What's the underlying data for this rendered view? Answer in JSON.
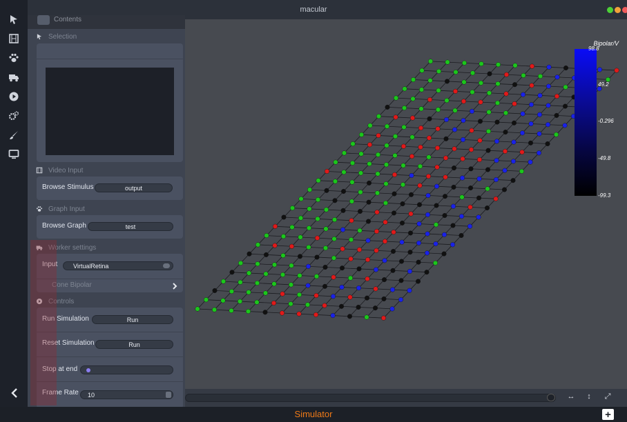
{
  "window": {
    "title": "macular"
  },
  "panel": {
    "header_label": "Contents"
  },
  "sections": {
    "selection": "Selection",
    "video_input": "Video Input",
    "graph_input": "Graph Input",
    "worker_settings": "Worker settings",
    "controls": "Controls"
  },
  "video_input": {
    "browse_label": "Browse Stimulus",
    "browse_value": "output"
  },
  "graph_input": {
    "browse_label": "Browse Graph",
    "browse_value": "test"
  },
  "worker": {
    "input_label": "Input",
    "input_value": "VirtualRetina",
    "submenu": "Cone Bipolar"
  },
  "controls": {
    "run_label": "Run Simulation",
    "run_button": "Run",
    "reset_label": "Reset Simulation",
    "reset_button": "Run",
    "stop_label": "Stop at end",
    "frame_rate_label": "Frame Rate",
    "frame_rate_value": "10"
  },
  "legend": {
    "title": "Bipolar/V",
    "ticks": [
      "98.8",
      "49.2",
      "-0.296",
      "-49.8",
      "-99.3"
    ]
  },
  "status": {
    "title": "Simulator"
  },
  "colors": {
    "accent": "#f07a17",
    "red": "#e01a1a",
    "green": "#1cc61c",
    "blue": "#1a22e8",
    "black": "#111111"
  },
  "icons": {
    "toolstrip": [
      "pointer-icon",
      "film-icon",
      "paw-icon",
      "truck-icon",
      "play-icon",
      "gears-icon",
      "brush-icon",
      "monitor-icon"
    ],
    "bottom": [
      "fit-horizontal-icon",
      "fit-vertical-icon",
      "expand-icon"
    ]
  }
}
